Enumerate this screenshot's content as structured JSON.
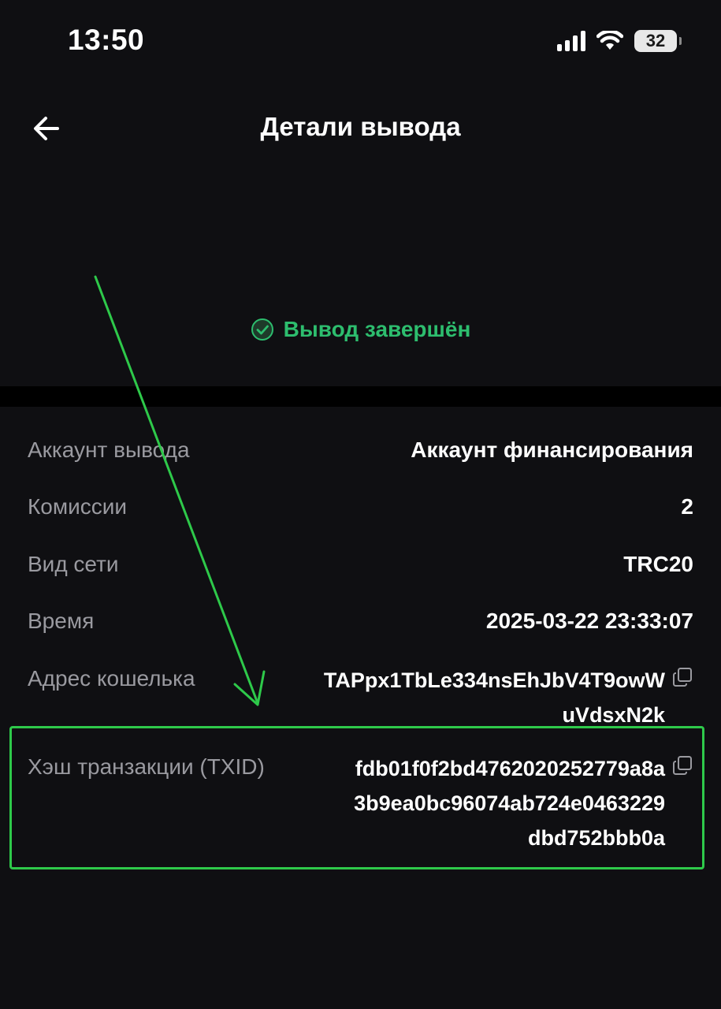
{
  "status_bar": {
    "time": "13:50",
    "battery": "32"
  },
  "header": {
    "title": "Детали вывода",
    "back_icon": "arrow-left-icon"
  },
  "status": {
    "text": "Вывод завершён",
    "icon": "check-circle-icon",
    "color": "#2dbd6e"
  },
  "details": {
    "rows": [
      {
        "label": "Аккаунт вывода",
        "value": "Аккаунт финансирования"
      },
      {
        "label": "Комиссии",
        "value": "2"
      },
      {
        "label": "Вид сети",
        "value": "TRC20"
      },
      {
        "label": "Время",
        "value": "2025-03-22 23:33:07"
      }
    ],
    "wallet": {
      "label": "Адрес кошелька",
      "lines": [
        "TAPpx1TbLe334nsEhJbV4T9owW",
        "uVdsxN2k"
      ],
      "copy_icon": "copy-icon"
    },
    "txid": {
      "label": "Хэш транзакции (TXID)",
      "lines": [
        "fdb01f0f2bd4762020252779a8a",
        "3b9ea0bc96074ab724e0463229",
        "dbd752bbb0a"
      ],
      "copy_icon": "copy-icon"
    }
  },
  "annotation": {
    "color": "#2ec94a"
  }
}
